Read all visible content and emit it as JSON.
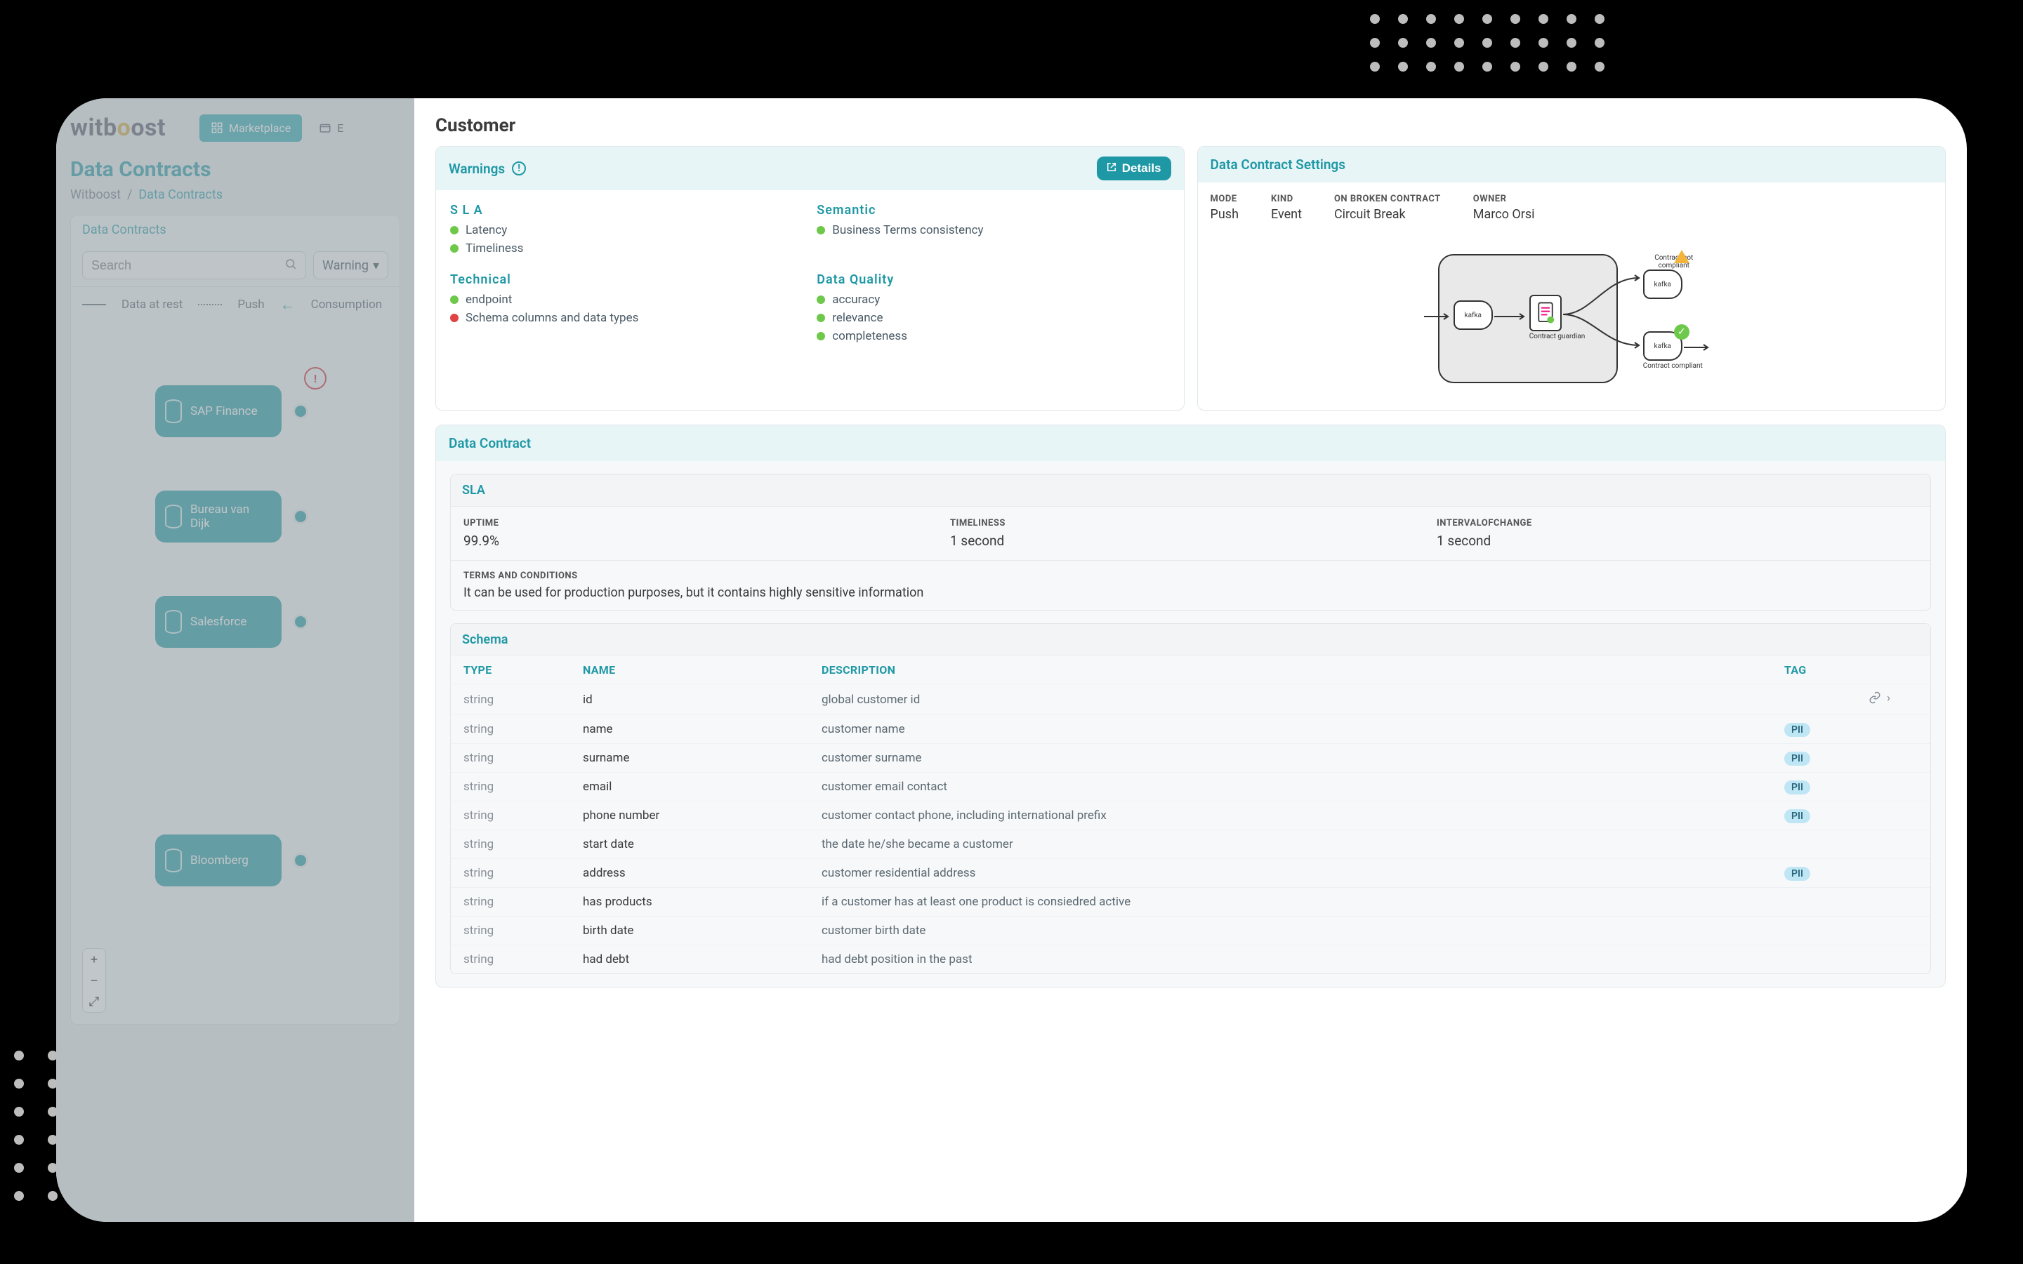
{
  "brand": {
    "part1": "witb",
    "part2": "o",
    "part3": "ost"
  },
  "topTabs": {
    "marketplace": "Marketplace",
    "other": "E"
  },
  "leftPanel": {
    "pageTitle": "Data Contracts",
    "breadcrumbs": {
      "root": "Witboost",
      "here": "Data Contracts"
    },
    "cardTitle": "Data Contracts",
    "searchPlaceholder": "Search",
    "warningSelect": "Warning",
    "legend": {
      "rest": "Data at rest",
      "push": "Push",
      "consumption": "Consumption"
    },
    "nodes": [
      "SAP Finance",
      "Bureau van Dijk",
      "Salesforce",
      "Bloomberg"
    ]
  },
  "main": {
    "title": "Customer",
    "warnings": {
      "header": "Warnings",
      "detailsBtn": "Details",
      "groups": [
        {
          "title": "S L A",
          "items": [
            {
              "status": "green",
              "text": "Latency"
            },
            {
              "status": "green",
              "text": "Timeliness"
            }
          ]
        },
        {
          "title": "Semantic",
          "items": [
            {
              "status": "green",
              "text": "Business Terms consistency"
            }
          ]
        },
        {
          "title": "Technical",
          "items": [
            {
              "status": "green",
              "text": "endpoint"
            },
            {
              "status": "red",
              "text": "Schema columns and data types"
            }
          ]
        },
        {
          "title": "Data Quality",
          "items": [
            {
              "status": "green",
              "text": "accuracy"
            },
            {
              "status": "green",
              "text": "relevance"
            },
            {
              "status": "green",
              "text": "completeness"
            }
          ]
        }
      ]
    },
    "settings": {
      "header": "Data Contract Settings",
      "kv": [
        {
          "k": "MODE",
          "v": "Push"
        },
        {
          "k": "KIND",
          "v": "Event"
        },
        {
          "k": "ON BROKEN CONTRACT",
          "v": "Circuit Break"
        },
        {
          "k": "OWNER",
          "v": "Marco Orsi"
        }
      ],
      "diagram": {
        "kafka": "kafka",
        "guardian": "Contract guardian",
        "notCompliant": "Contract not compliant",
        "compliant": "Contract compliant"
      }
    },
    "contract": {
      "header": "Data Contract",
      "slaHeader": "SLA",
      "sla": [
        {
          "k": "UPTIME",
          "v": "99.9%"
        },
        {
          "k": "TIMELINESS",
          "v": "1 second"
        },
        {
          "k": "INTERVALOFCHANGE",
          "v": "1 second"
        }
      ],
      "tcLabel": "TERMS AND CONDITIONS",
      "tcValue": "It can be used for production purposes, but it contains highly sensitive information",
      "schemaHeader": "Schema",
      "schemaCols": {
        "type": "TYPE",
        "name": "NAME",
        "desc": "DESCRIPTION",
        "tag": "TAG"
      },
      "schemaRows": [
        {
          "type": "string",
          "name": "id",
          "desc": "global customer id",
          "tag": "",
          "action": true
        },
        {
          "type": "string",
          "name": "name",
          "desc": "customer name",
          "tag": "PII"
        },
        {
          "type": "string",
          "name": "surname",
          "desc": "customer surname",
          "tag": "PII"
        },
        {
          "type": "string",
          "name": "email",
          "desc": "customer email contact",
          "tag": "PII"
        },
        {
          "type": "string",
          "name": "phone number",
          "desc": "customer contact phone, including international prefix",
          "tag": "PII"
        },
        {
          "type": "string",
          "name": "start date",
          "desc": "the date he/she became a customer",
          "tag": ""
        },
        {
          "type": "string",
          "name": "address",
          "desc": "customer residential address",
          "tag": "PII"
        },
        {
          "type": "string",
          "name": "has products",
          "desc": "if a customer has at least one product is consiedred active",
          "tag": ""
        },
        {
          "type": "string",
          "name": "birth date",
          "desc": "customer birth date",
          "tag": ""
        },
        {
          "type": "string",
          "name": "had debt",
          "desc": "had debt position in the past",
          "tag": ""
        }
      ]
    }
  }
}
